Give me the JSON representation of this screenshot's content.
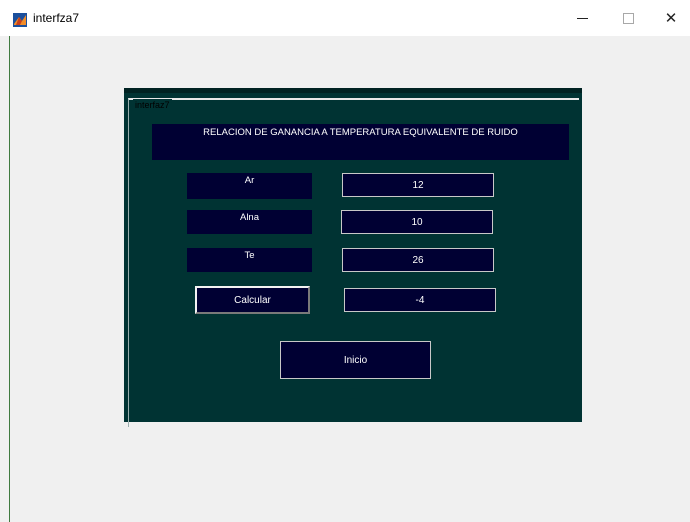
{
  "window": {
    "title": "interfza7",
    "icon": "matlab-icon",
    "minimize_glyph": "",
    "maximize_glyph": "",
    "close_glyph": "✕"
  },
  "panel": {
    "title": "interfaz7",
    "header": "RELACION DE GANANCIA A TEMPERATURA EQUIVALENTE DE RUIDO",
    "labels": {
      "ar": "Ar",
      "alna": "Alna",
      "te": "Te"
    },
    "fields": {
      "ar": "12",
      "alna": "10",
      "te": "26",
      "result": "-4"
    },
    "buttons": {
      "calcular": "Calcular",
      "inicio": "Inicio"
    }
  },
  "colors": {
    "panel_bg": "#003333",
    "box_bg": "#000033",
    "text": "#ffffff"
  }
}
